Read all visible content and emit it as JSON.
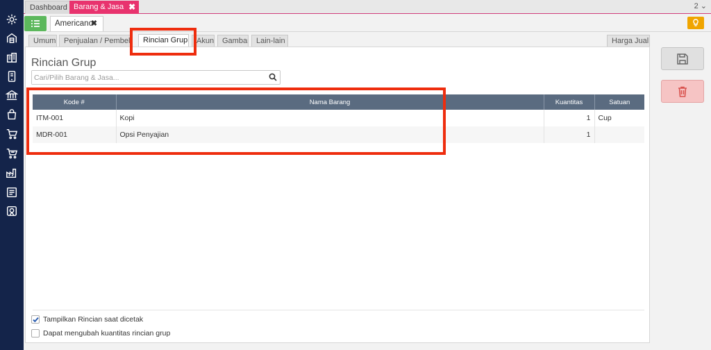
{
  "topbar": {
    "tabs": [
      {
        "label": "Dashboard"
      },
      {
        "label": "Barang & Jasa",
        "close": "✖"
      }
    ],
    "right_label": "2 ⌄"
  },
  "document": {
    "tab_label": "Americano",
    "close": "✖"
  },
  "inner_tabs": [
    "Umum",
    "Penjualan / Pembelian",
    "Rincian Grup",
    "Akun",
    "Gambar",
    "Lain-lain",
    "Harga Jual"
  ],
  "active_inner_tab": "Rincian Grup",
  "panel": {
    "title": "Rincian Grup",
    "search_placeholder": "Cari/Pilih Barang & Jasa..."
  },
  "table": {
    "columns": [
      "Kode #",
      "Nama Barang",
      "Kuantitas",
      "Satuan"
    ],
    "rows": [
      {
        "kode": "ITM-001",
        "nama": "Kopi",
        "kuantitas": "1",
        "satuan": "Cup"
      },
      {
        "kode": "MDR-001",
        "nama": "Opsi Penyajian",
        "kuantitas": "1",
        "satuan": ""
      }
    ]
  },
  "options": {
    "print_details": {
      "label": "Tampilkan Rincian saat dicetak",
      "checked": true
    },
    "editable_qty": {
      "label": "Dapat mengubah kuantitas rincian grup",
      "checked": false
    }
  },
  "icons": {
    "sidebar": [
      "gear-icon",
      "warehouse-icon",
      "building-icon",
      "mobile-icon",
      "bank-icon",
      "bag-icon",
      "cart-icon",
      "cart-alt-icon",
      "factory-icon",
      "report-icon",
      "badge-icon"
    ],
    "actions": [
      "save-icon",
      "trash-icon",
      "bulb-icon",
      "list-icon",
      "search-icon"
    ]
  },
  "colors": {
    "sidebar": "#14244a",
    "active_tab": "#e8336e",
    "list_button": "#5cb85c",
    "bulb_button": "#f0a500",
    "table_header": "#5a6b80",
    "annotation": "#ee2d0e"
  }
}
